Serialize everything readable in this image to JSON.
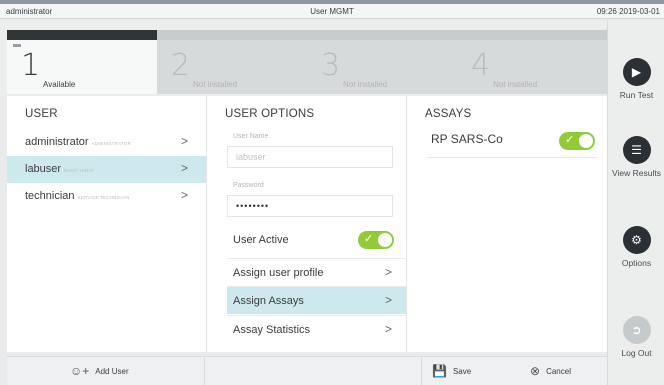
{
  "window": {
    "user": "administrator",
    "title": "User MGMT",
    "datetime": "09:26 2019-03-01"
  },
  "modules": [
    {
      "num": "1",
      "label": "Available",
      "active": true
    },
    {
      "num": "2",
      "label": "Not installed",
      "active": false
    },
    {
      "num": "3",
      "label": "Not installed",
      "active": false
    },
    {
      "num": "4",
      "label": "Not installed",
      "active": false
    }
  ],
  "sidebar": {
    "run_test": "Run Test",
    "view_results": "View Results",
    "options": "Options",
    "log_out": "Log Out"
  },
  "user_panel": {
    "title": "USER",
    "users": [
      {
        "name": "administrator",
        "role": "ADMINISTRATOR"
      },
      {
        "name": "labuser",
        "role": "BASIC USER"
      },
      {
        "name": "technician",
        "role": "SERVICE TECHNICIAN"
      }
    ]
  },
  "options_panel": {
    "title": "USER OPTIONS",
    "user_name_label": "User Name",
    "user_name_value": "labuser",
    "password_label": "Password",
    "password_value": "••••••••",
    "user_active_label": "User Active",
    "assign_profile": "Assign user profile",
    "assign_assays": "Assign Assays",
    "assay_statistics": "Assay Statistics"
  },
  "assays_panel": {
    "title": "ASSAYS",
    "items": [
      {
        "name": "RP SARS-Co",
        "enabled": true
      }
    ]
  },
  "bottom": {
    "add_user": "Add User",
    "save": "Save",
    "cancel": "Cancel"
  },
  "colors": {
    "toggle_on": "#93cb38",
    "selected_row": "#cde9ee",
    "dark_button": "#2a3034"
  }
}
